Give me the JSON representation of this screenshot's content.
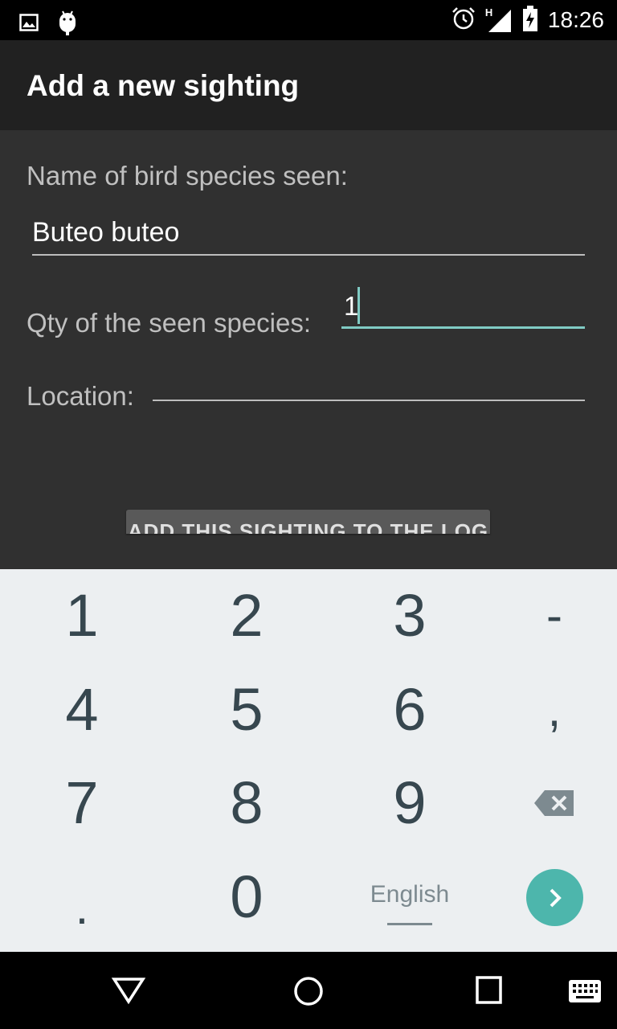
{
  "status_bar": {
    "time": "18:26",
    "network_label": "H",
    "icons": [
      "picture-icon",
      "android-debug-icon",
      "alarm-icon",
      "signal-icon",
      "battery-icon"
    ]
  },
  "app_bar": {
    "title": "Add a new sighting"
  },
  "form": {
    "species_label": "Name of bird species seen:",
    "species_value": "Buteo buteo",
    "qty_label": "Qty of the seen species:",
    "qty_value": "1",
    "location_label": "Location:",
    "location_value": "",
    "submit_label": "ADD THIS SIGHTING TO THE LOG"
  },
  "keyboard": {
    "keys": [
      [
        "1",
        "2",
        "3",
        "-"
      ],
      [
        "4",
        "5",
        "6",
        ","
      ],
      [
        "7",
        "8",
        "9",
        "delete"
      ],
      [
        ".",
        "0",
        "English",
        "next"
      ]
    ],
    "language": "English"
  },
  "nav_bar": {
    "icons": [
      "back-icon",
      "home-icon",
      "recents-icon",
      "keyboard-icon"
    ]
  },
  "colors": {
    "accent": "#80cbc4",
    "enter_button": "#4db6ac",
    "app_bar": "#212121",
    "background": "#303030",
    "keyboard_bg": "#eceff1",
    "key_text": "#37474f"
  }
}
